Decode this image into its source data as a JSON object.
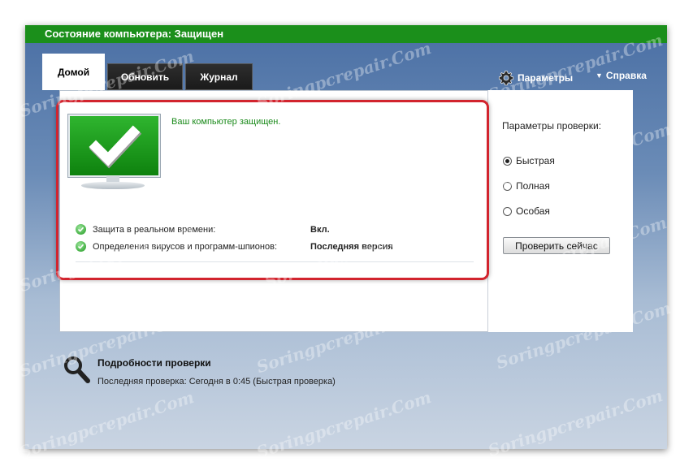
{
  "window": {
    "title": "Состояние компьютера: Защищен"
  },
  "tabs": [
    {
      "label": "Домой",
      "active": true
    },
    {
      "label": "Обновить",
      "active": false
    },
    {
      "label": "Журнал",
      "active": false
    }
  ],
  "topbar": {
    "settings_label": "Параметры",
    "help_label": "Справка"
  },
  "status": {
    "message": "Ваш компьютер защищен.",
    "rows": [
      {
        "label": "Защита в реальном времени:",
        "value": "Вкл."
      },
      {
        "label": "Определения вирусов и программ-шпионов:",
        "value": "Последняя версия"
      }
    ]
  },
  "scan_options": {
    "label": "Параметры проверки:",
    "options": [
      {
        "label": "Быстрая",
        "selected": true
      },
      {
        "label": "Полная",
        "selected": false
      },
      {
        "label": "Особая",
        "selected": false
      }
    ],
    "button_label": "Проверить сейчас"
  },
  "details": {
    "title": "Подробности проверки",
    "last_scan": "Последняя проверка:  Сегодня в 0:45 (Быстрая проверка)"
  },
  "watermark": "Soringpcrepair.Com",
  "colors": {
    "titlebar": "#1b8f1b",
    "status_text": "#1a8a1a",
    "highlight_border": "#d2242e"
  }
}
